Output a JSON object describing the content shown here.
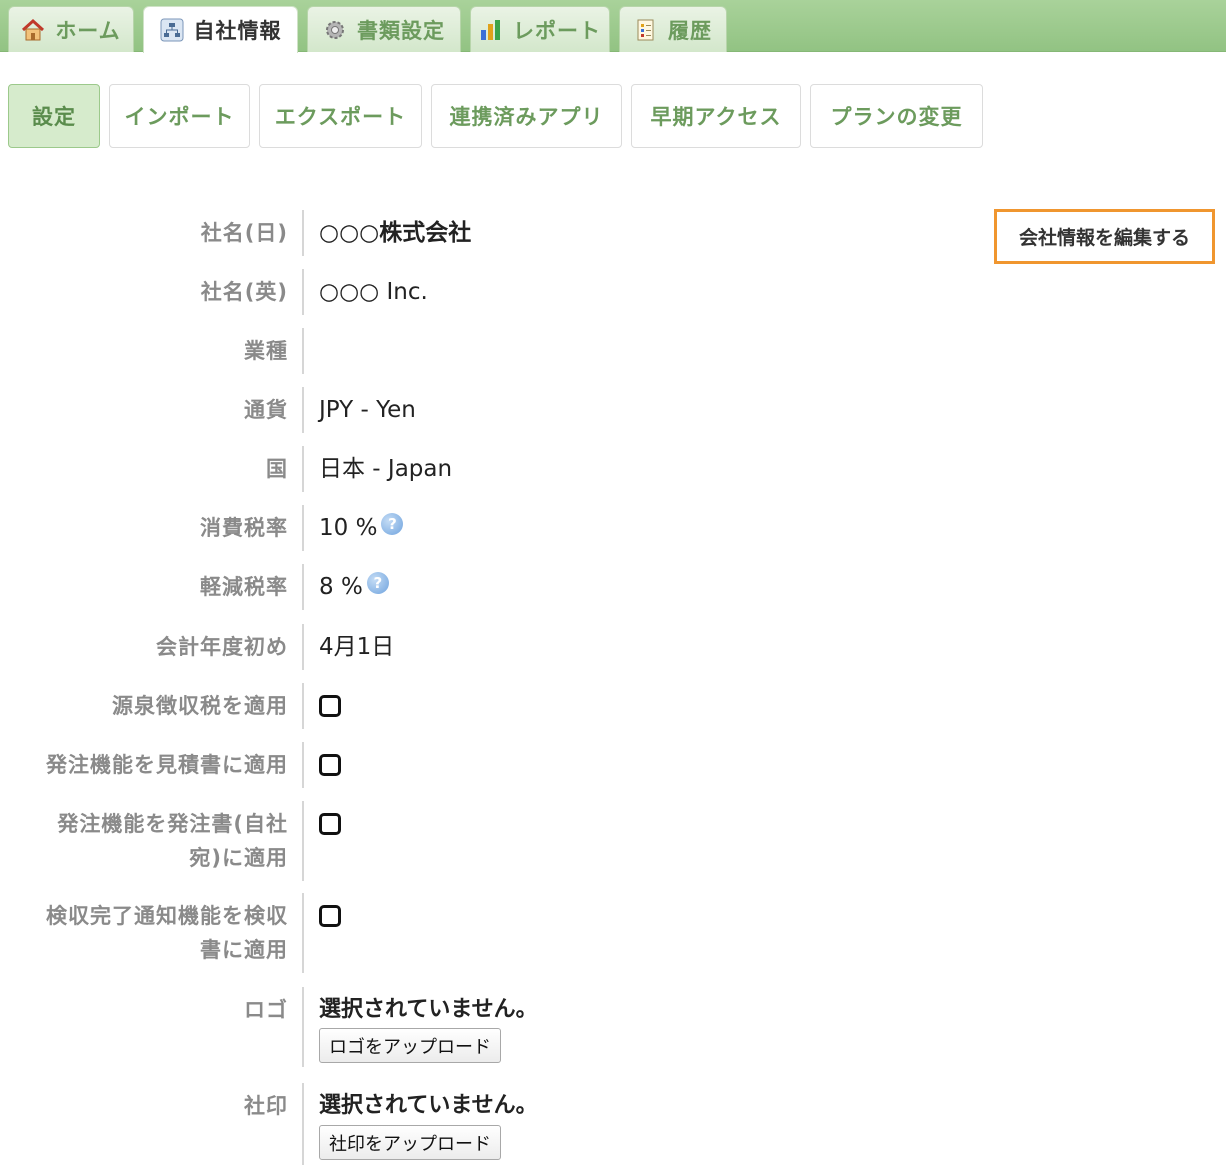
{
  "tabs": [
    {
      "label": "ホーム",
      "icon": "home-icon"
    },
    {
      "label": "自社情報",
      "icon": "org-chart-icon"
    },
    {
      "label": "書類設定",
      "icon": "gear-icon"
    },
    {
      "label": "レポート",
      "icon": "bar-chart-icon"
    },
    {
      "label": "履歴",
      "icon": "history-icon"
    }
  ],
  "active_tab": "自社情報",
  "subnav": [
    "設定",
    "インポート",
    "エクスポート",
    "連携済みアプリ",
    "早期アクセス",
    "プランの変更"
  ],
  "active_subnav": "設定",
  "edit_button": "会社情報を編集する",
  "fields": {
    "name_ja": {
      "label": "社名(日)",
      "value": "○○○株式会社"
    },
    "name_en": {
      "label": "社名(英)",
      "value": "○○○ Inc."
    },
    "industry": {
      "label": "業種",
      "value": ""
    },
    "currency": {
      "label": "通貨",
      "value": "JPY - Yen"
    },
    "country": {
      "label": "国",
      "value": "日本 - Japan"
    },
    "tax_rate": {
      "label": "消費税率",
      "value": "10 %"
    },
    "reduced_tax_rate": {
      "label": "軽減税率",
      "value": "8 %"
    },
    "fiscal_start": {
      "label": "会計年度初め",
      "value": "4月1日"
    },
    "withholding": {
      "label": "源泉徴収税を適用",
      "checked": false
    },
    "order_on_estimate": {
      "label": "発注機能を見積書に適用",
      "checked": false
    },
    "order_on_po_line1": {
      "label": "発注機能を発注書(自社"
    },
    "order_on_po_line2": {
      "label": "宛)に適用",
      "checked": false
    },
    "inspection_line1": {
      "label": "検収完了通知機能を検収"
    },
    "inspection_line2": {
      "label": "書に適用",
      "checked": false
    },
    "logo": {
      "label": "ロゴ",
      "status": "選択されていません。",
      "button": "ロゴをアップロード"
    },
    "seal": {
      "label": "社印",
      "status": "選択されていません。",
      "button": "社印をアップロード"
    }
  },
  "help_icon": "question-icon",
  "colors": {
    "accent_green": "#6c9b5d",
    "edit_border": "#f0962f",
    "tab_bar": "#a9d29a"
  }
}
